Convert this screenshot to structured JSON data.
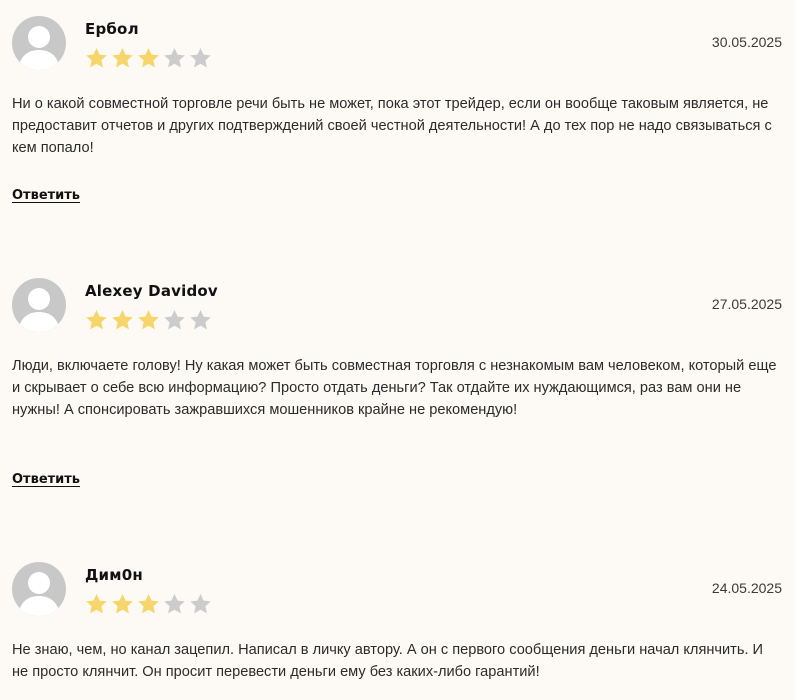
{
  "colors": {
    "background": "#fdfaf6",
    "star_filled": "#f6d66a",
    "star_empty": "#cccccc",
    "avatar_bg": "#c8c8c8"
  },
  "reviews": [
    {
      "author": "Ербол",
      "date": "30.05.2025",
      "rating": 3,
      "max_rating": 5,
      "text": "Ни о какой совместной торговле речи быть не может, пока этот трейдер, если он вообще таковым является, не предоставит отчетов и других подтверждений своей честной деятельности! А до тех пор не надо связываться с кем попало!",
      "reply_label": "Ответить"
    },
    {
      "author": "Alexey Davidov",
      "date": "27.05.2025",
      "rating": 3,
      "max_rating": 5,
      "text": "Люди, включаете голову! Ну какая может быть совместная торговля с незнакомым вам человеком, который еще и скрывает о себе всю информацию? Просто отдать деньги? Так отдайте их нуждающимся, раз вам они не нужны! А спонсировать зажравшихся мошенников крайне не рекомендую!",
      "reply_label": "Ответить"
    },
    {
      "author": "Дим0н",
      "date": "24.05.2025",
      "rating": 3,
      "max_rating": 5,
      "text": "Не знаю, чем, но канал зацепил. Написал в личку автору. А он с первого сообщения деньги начал клянчить. И не просто клянчит. Он просит перевести деньги ему без каких-либо гарантий!",
      "reply_label": ""
    }
  ]
}
